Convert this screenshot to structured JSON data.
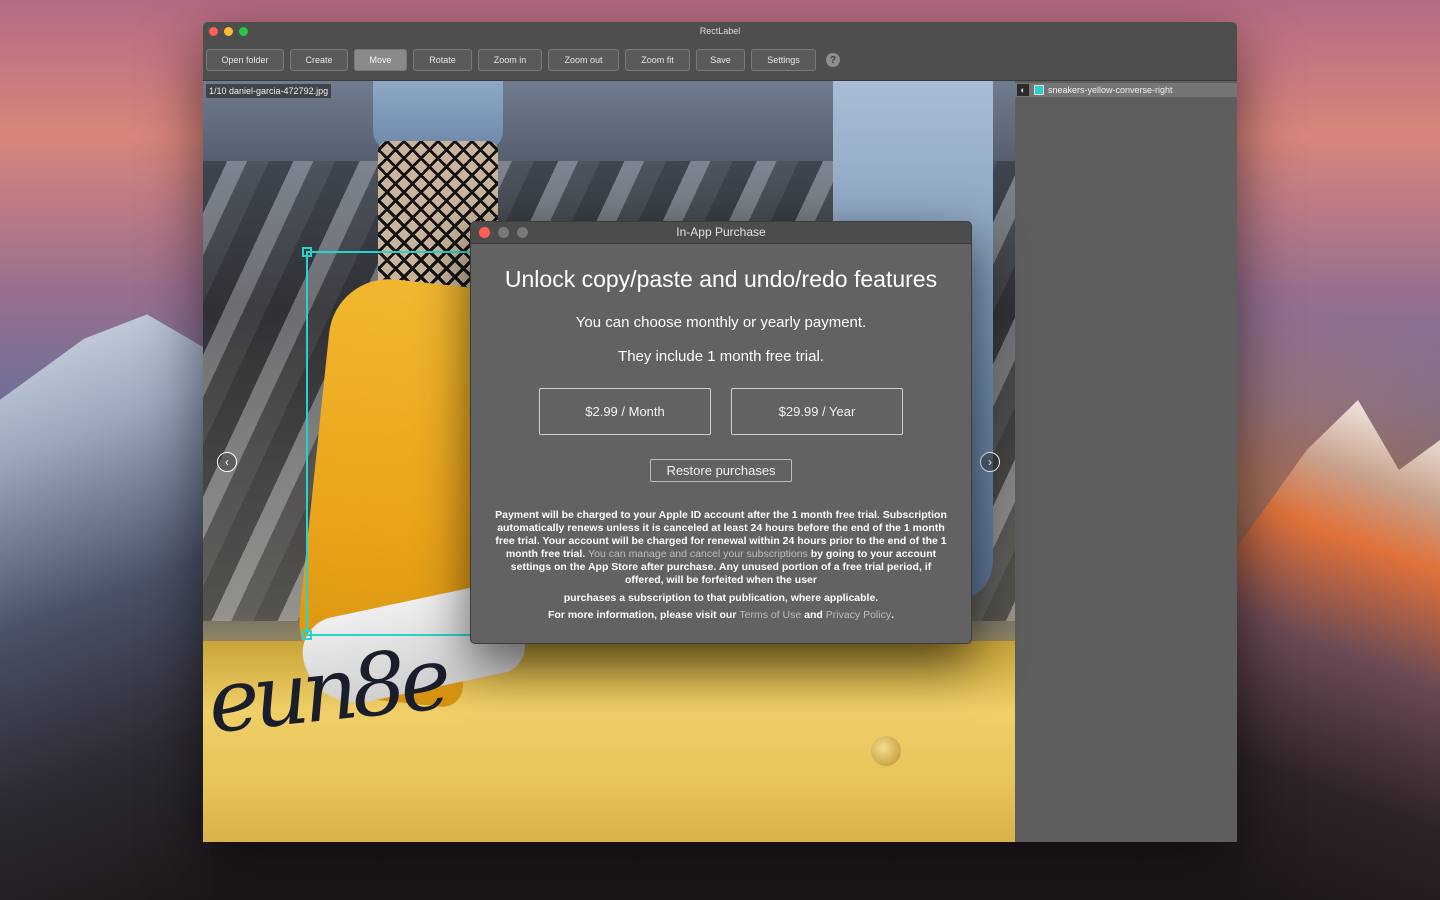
{
  "window": {
    "title": "RectLabel"
  },
  "toolbar": {
    "open_folder": "Open folder",
    "create": "Create",
    "move": "Move",
    "rotate": "Rotate",
    "zoom_in": "Zoom in",
    "zoom_out": "Zoom out",
    "zoom_fit": "Zoom fit",
    "save": "Save",
    "settings": "Settings",
    "help": "?"
  },
  "canvas": {
    "file_label": "1/10 daniel-garcia-472792.jpg",
    "prev_arrow": "‹",
    "next_arrow": "›",
    "scribble": "eun8e",
    "box_color": "#27d3cb"
  },
  "sidebar": {
    "contrast_icon": "◐",
    "label_name": "sneakers-yellow-converse-right",
    "label_color": "#27d3cb"
  },
  "dialog": {
    "title": "In-App Purchase",
    "headline": "Unlock copy/paste and undo/redo features",
    "sub1": "You can choose monthly or yearly payment.",
    "sub2": "They include 1 month free trial.",
    "monthly": "$2.99 / Month",
    "yearly": "$29.99 / Year",
    "restore": "Restore purchases",
    "legal_a": "Payment will be charged to your Apple ID account after the 1 month free trial. Subscription automatically renews unless it is canceled at least 24 hours before the end of the 1 month free trial. Your account will be charged for renewal within 24 hours prior to the end of the 1 month free trial.",
    "legal_b": "You can manage and cancel your subscriptions",
    "legal_c": "by going to your account settings on the App Store after purchase. Any unused portion of a free trial period, if offered, will be forfeited when the user",
    "legal_d": "purchases a subscription to that publication, where applicable.",
    "info_prefix": "For more information, please visit our",
    "terms": "Terms of Use",
    "and": "and",
    "privacy": "Privacy Policy",
    "period": "."
  }
}
